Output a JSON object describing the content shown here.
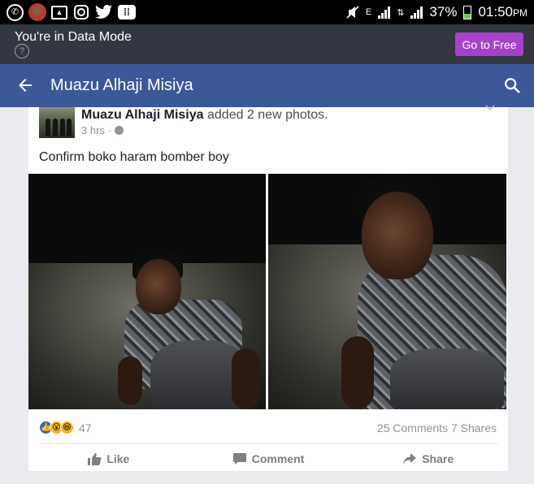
{
  "status_bar": {
    "battery": "37%",
    "time": "01:50",
    "ampm": "PM",
    "network": "E"
  },
  "banner": {
    "mode_text": "You're in Data Mode",
    "help": "?",
    "go_free_label": "Go to Free"
  },
  "nav": {
    "title": "Muazu Alhaji Misiya"
  },
  "post": {
    "author": "Muazu Alhaji Misiya",
    "action": " added 2 new photos.",
    "time": "3 hrs",
    "dot": "·",
    "text": "Confirm boko haram bomber boy",
    "reactions_count": "47",
    "stats": "25 Comments 7 Shares",
    "like_label": "Like",
    "comment_label": "Comment",
    "share_label": "Share"
  },
  "colors": {
    "facebook_blue": "#3b5998",
    "go_free_purple": "#a542c9",
    "banner_bg": "#333741"
  },
  "icons": [
    "whatsapp-icon",
    "avatar-icon",
    "gallery-icon",
    "instagram-icon",
    "twitter-icon",
    "bbm-icon",
    "mute-icon",
    "signal-icon",
    "battery-icon",
    "back-arrow-icon",
    "search-icon",
    "globe-icon",
    "like-icon",
    "comment-icon",
    "share-icon"
  ]
}
